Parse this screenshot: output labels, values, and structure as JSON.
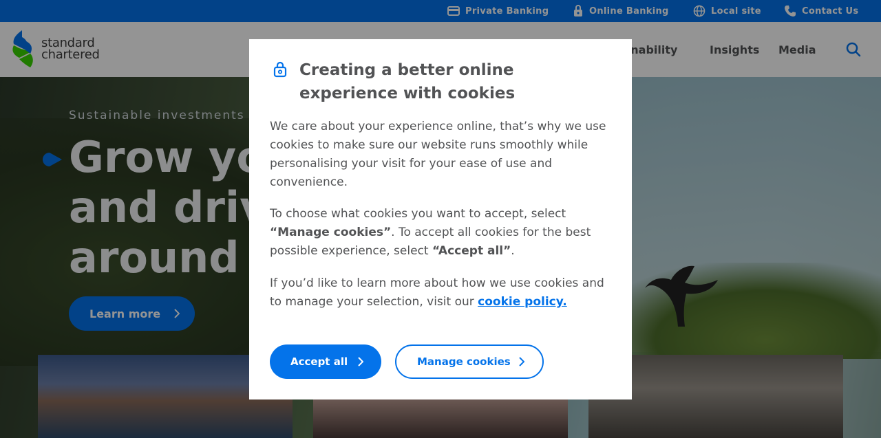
{
  "utility": {
    "links": [
      {
        "label": "Private Banking",
        "icon": "wallet-icon"
      },
      {
        "label": "Online Banking",
        "icon": "lock-icon"
      },
      {
        "label": "Local site",
        "icon": "globe-icon"
      },
      {
        "label": "Contact Us",
        "icon": "phone-icon"
      }
    ]
  },
  "header": {
    "logo_line1": "standard",
    "logo_line2": "chartered",
    "nav": [
      "ainability",
      "Insights",
      "Media"
    ]
  },
  "hero": {
    "eyebrow": "Sustainable investments",
    "title_line1": "Grow your",
    "title_line2": "and drive",
    "title_line3": "around th",
    "cta": "Learn more"
  },
  "modal": {
    "title": "Creating a better online experience with cookies",
    "p1": "We care about your experience online, that’s why we use cookies to make sure our website runs smoothly while personalising your visit for your ease of use and convenience.",
    "p2_a": "To choose what cookies you want to accept, select ",
    "p2_b": "“Manage cookies”",
    "p2_c": ". To accept all cookies for the best possible experience, select ",
    "p2_d": "“Accept all”",
    "p2_e": ".",
    "p3_a": "If you’d like to learn more about how we use cookies and to manage your selection, visit our ",
    "p3_link": "cookie policy.",
    "accept_label": "Accept all",
    "manage_label": "Manage cookies"
  },
  "colors": {
    "brand_blue": "#0473ea",
    "brand_green": "#38d200",
    "text_gray": "#525355"
  }
}
